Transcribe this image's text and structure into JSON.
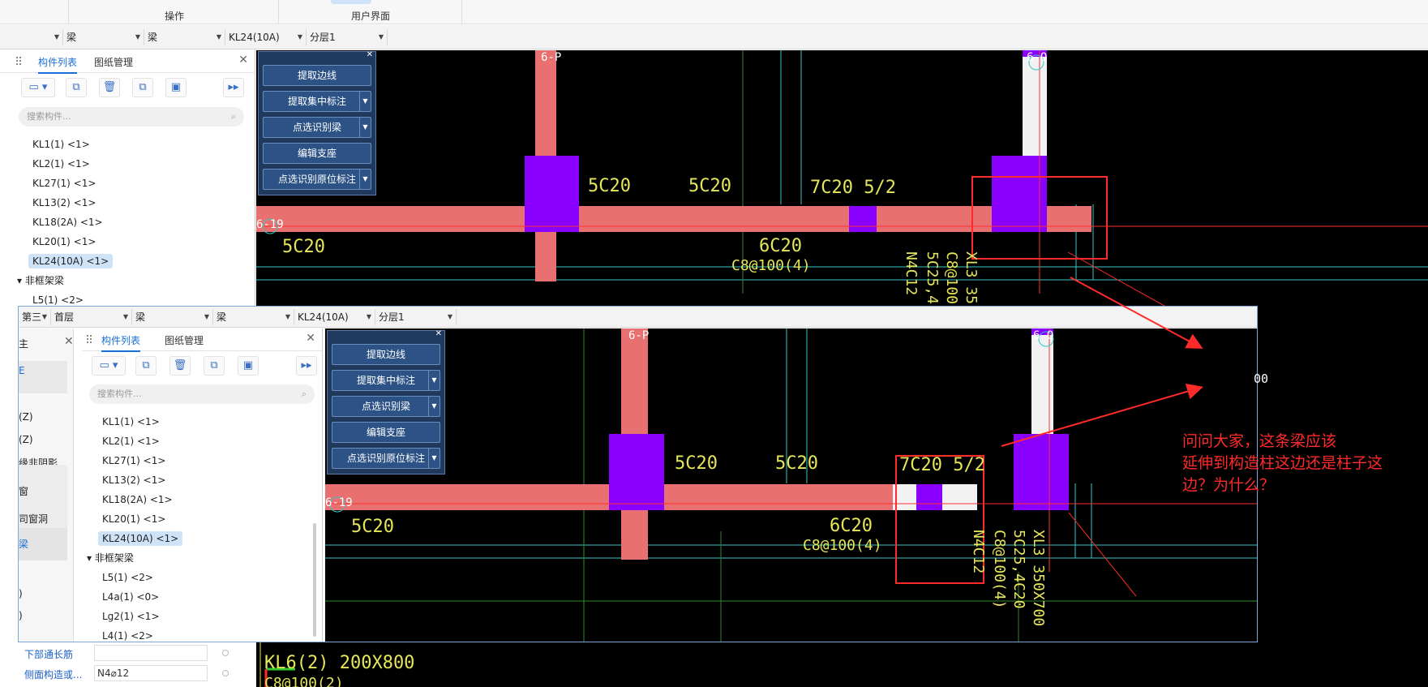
{
  "ribbon": {
    "group1": "操作",
    "group2": "用户界面"
  },
  "top": {
    "selectors": [
      "",
      "梁",
      "梁",
      "KL24(10A)",
      "分层1"
    ],
    "tabs": {
      "components": "构件列表",
      "drawings": "图纸管理"
    },
    "search_placeholder": "搜索构件...",
    "items": [
      "KL1(1) <1>",
      "KL2(1) <1>",
      "KL27(1) <1>",
      "KL13(2) <1>",
      "KL18(2A) <1>",
      "KL20(1) <1>",
      "KL24(10A) <1>"
    ],
    "group_label": "非框架梁",
    "sub_item": "L5(1) <2>",
    "commands": [
      "提取边线",
      "提取集中标注",
      "点选识别梁",
      "编辑支座",
      "点选识别原位标注"
    ]
  },
  "bottom": {
    "selectors": [
      "第三",
      "首层",
      "梁",
      "梁",
      "KL24(10A)",
      "分层1"
    ],
    "tabs": {
      "components": "构件列表",
      "drawings": "图纸管理"
    },
    "search_placeholder": "搜索构件...",
    "items": [
      "KL1(1) <1>",
      "KL2(1) <1>",
      "KL27(1) <1>",
      "KL13(2) <1>",
      "KL18(2A) <1>",
      "KL20(1) <1>",
      "KL24(10A) <1>"
    ],
    "group_label": "非框架梁",
    "sub_items": [
      "L5(1) <2>",
      "L4a(1) <0>",
      "Lg2(1) <1>",
      "L4(1) <2>"
    ],
    "left_strip": [
      "主",
      "E",
      "(Z)",
      "(Z)",
      "缘非阴影...",
      "窗",
      "司窗洞",
      "梁",
      ")",
      ")"
    ],
    "commands": [
      "提取边线",
      "提取集中标注",
      "点选识别梁",
      "编辑支座",
      "点选识别原位标注"
    ]
  },
  "props": {
    "row1_label": "下部通长筋",
    "row1_value": "",
    "row2_label": "侧面构造或...",
    "row2_value": "N4⌀12"
  },
  "cad_top": {
    "axis_a": "6-P",
    "axis_b": "6-Q",
    "axis_c": "6-19",
    "labels": [
      "5C20",
      "5C20",
      "7C20 5/2",
      "5C20",
      "6C20",
      "C8@100(4)"
    ],
    "vlabels": [
      "N4C12",
      "5C25,4",
      "C8@100",
      "XL3 35"
    ]
  },
  "cad_bottom": {
    "axis_a": "6-P",
    "axis_b": "6-Q",
    "axis_c": "6-19",
    "labels": [
      "5C20",
      "5C20",
      "7C20 5/2",
      "5C20",
      "6C20",
      "C8@100(4)"
    ],
    "vlabels": [
      "N4C12",
      "C8@100(4)",
      "5C25,4C20",
      "XL3 350X700"
    ]
  },
  "cad_extra": {
    "right_text": "00",
    "beam_label": "KL6(2) 200X800",
    "beam_label2": "C8@100(2)"
  },
  "note": {
    "line1": "问问大家，这条梁应该",
    "line2": "延伸到构造柱这边还是柱子这",
    "line3": "边？为什么？"
  },
  "colors": {
    "beam": "#e87070",
    "column": "#8a00ff",
    "annotation": "#ff2a2a",
    "text_yellow": "#e6e65a",
    "axis_cyan": "#33c9c9"
  }
}
